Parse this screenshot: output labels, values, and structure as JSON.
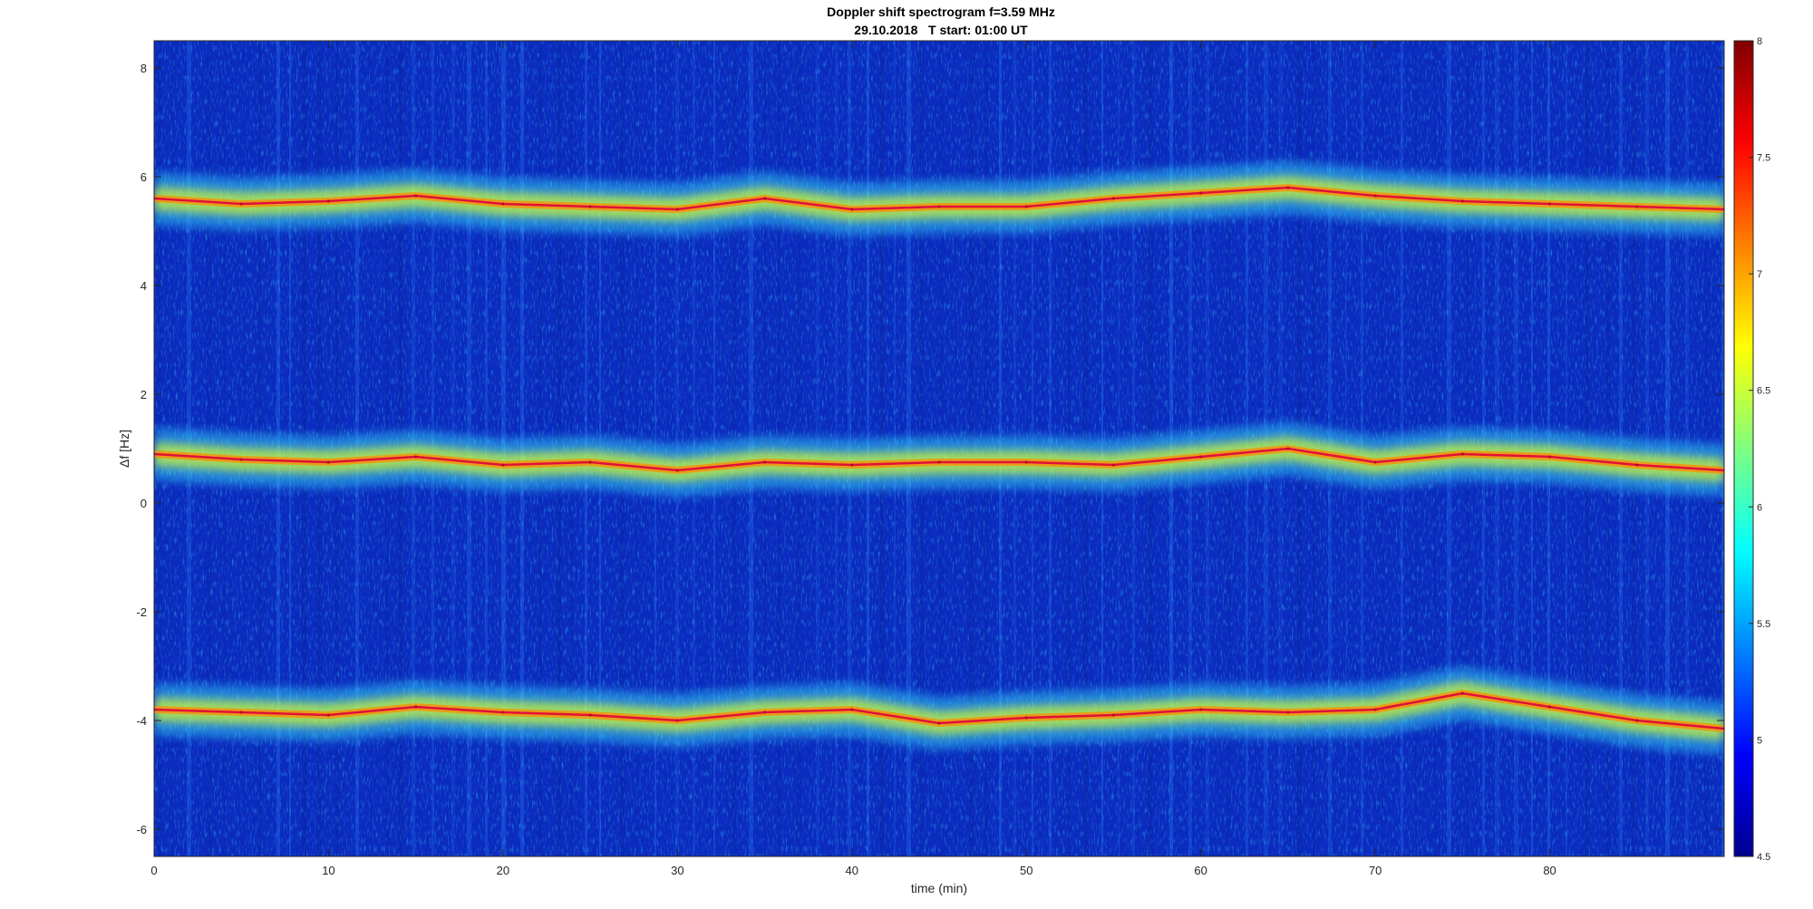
{
  "chart_data": {
    "type": "heatmap",
    "title": "Doppler shift spectrogram f=3.59 MHz",
    "subtitle": "29.10.2018   T start: 01:00 UT",
    "xlabel": "time (min)",
    "ylabel": "Δf [Hz]",
    "xlim": [
      0,
      90
    ],
    "ylim": [
      -6.5,
      8.5
    ],
    "xticks": [
      0,
      10,
      20,
      30,
      40,
      50,
      60,
      70,
      80
    ],
    "yticks": [
      -6,
      -4,
      -2,
      0,
      2,
      4,
      6,
      8
    ],
    "colormap": "jet",
    "clim": [
      4.5,
      8
    ],
    "colorbar_ticks": [
      4.5,
      5,
      5.5,
      6,
      6.5,
      7,
      7.5,
      8
    ],
    "traces": [
      {
        "time": [
          0,
          5,
          10,
          15,
          20,
          25,
          30,
          35,
          40,
          45,
          50,
          55,
          60,
          65,
          70,
          75,
          80,
          85,
          90
        ],
        "freq": [
          5.6,
          5.5,
          5.55,
          5.65,
          5.5,
          5.45,
          5.4,
          5.6,
          5.4,
          5.45,
          5.45,
          5.6,
          5.7,
          5.8,
          5.65,
          5.55,
          5.5,
          5.45,
          5.4
        ]
      },
      {
        "time": [
          0,
          5,
          10,
          15,
          20,
          25,
          30,
          35,
          40,
          45,
          50,
          55,
          60,
          65,
          70,
          75,
          80,
          85,
          90
        ],
        "freq": [
          0.9,
          0.8,
          0.75,
          0.85,
          0.7,
          0.75,
          0.6,
          0.75,
          0.7,
          0.75,
          0.75,
          0.7,
          0.85,
          1.0,
          0.75,
          0.9,
          0.85,
          0.7,
          0.6
        ]
      },
      {
        "time": [
          0,
          5,
          10,
          15,
          20,
          25,
          30,
          35,
          40,
          45,
          50,
          55,
          60,
          65,
          70,
          75,
          80,
          85,
          90
        ],
        "freq": [
          -3.8,
          -3.85,
          -3.9,
          -3.75,
          -3.85,
          -3.9,
          -4.0,
          -3.85,
          -3.8,
          -4.05,
          -3.95,
          -3.9,
          -3.8,
          -3.85,
          -3.8,
          -3.5,
          -3.75,
          -4.0,
          -4.15
        ]
      }
    ]
  }
}
